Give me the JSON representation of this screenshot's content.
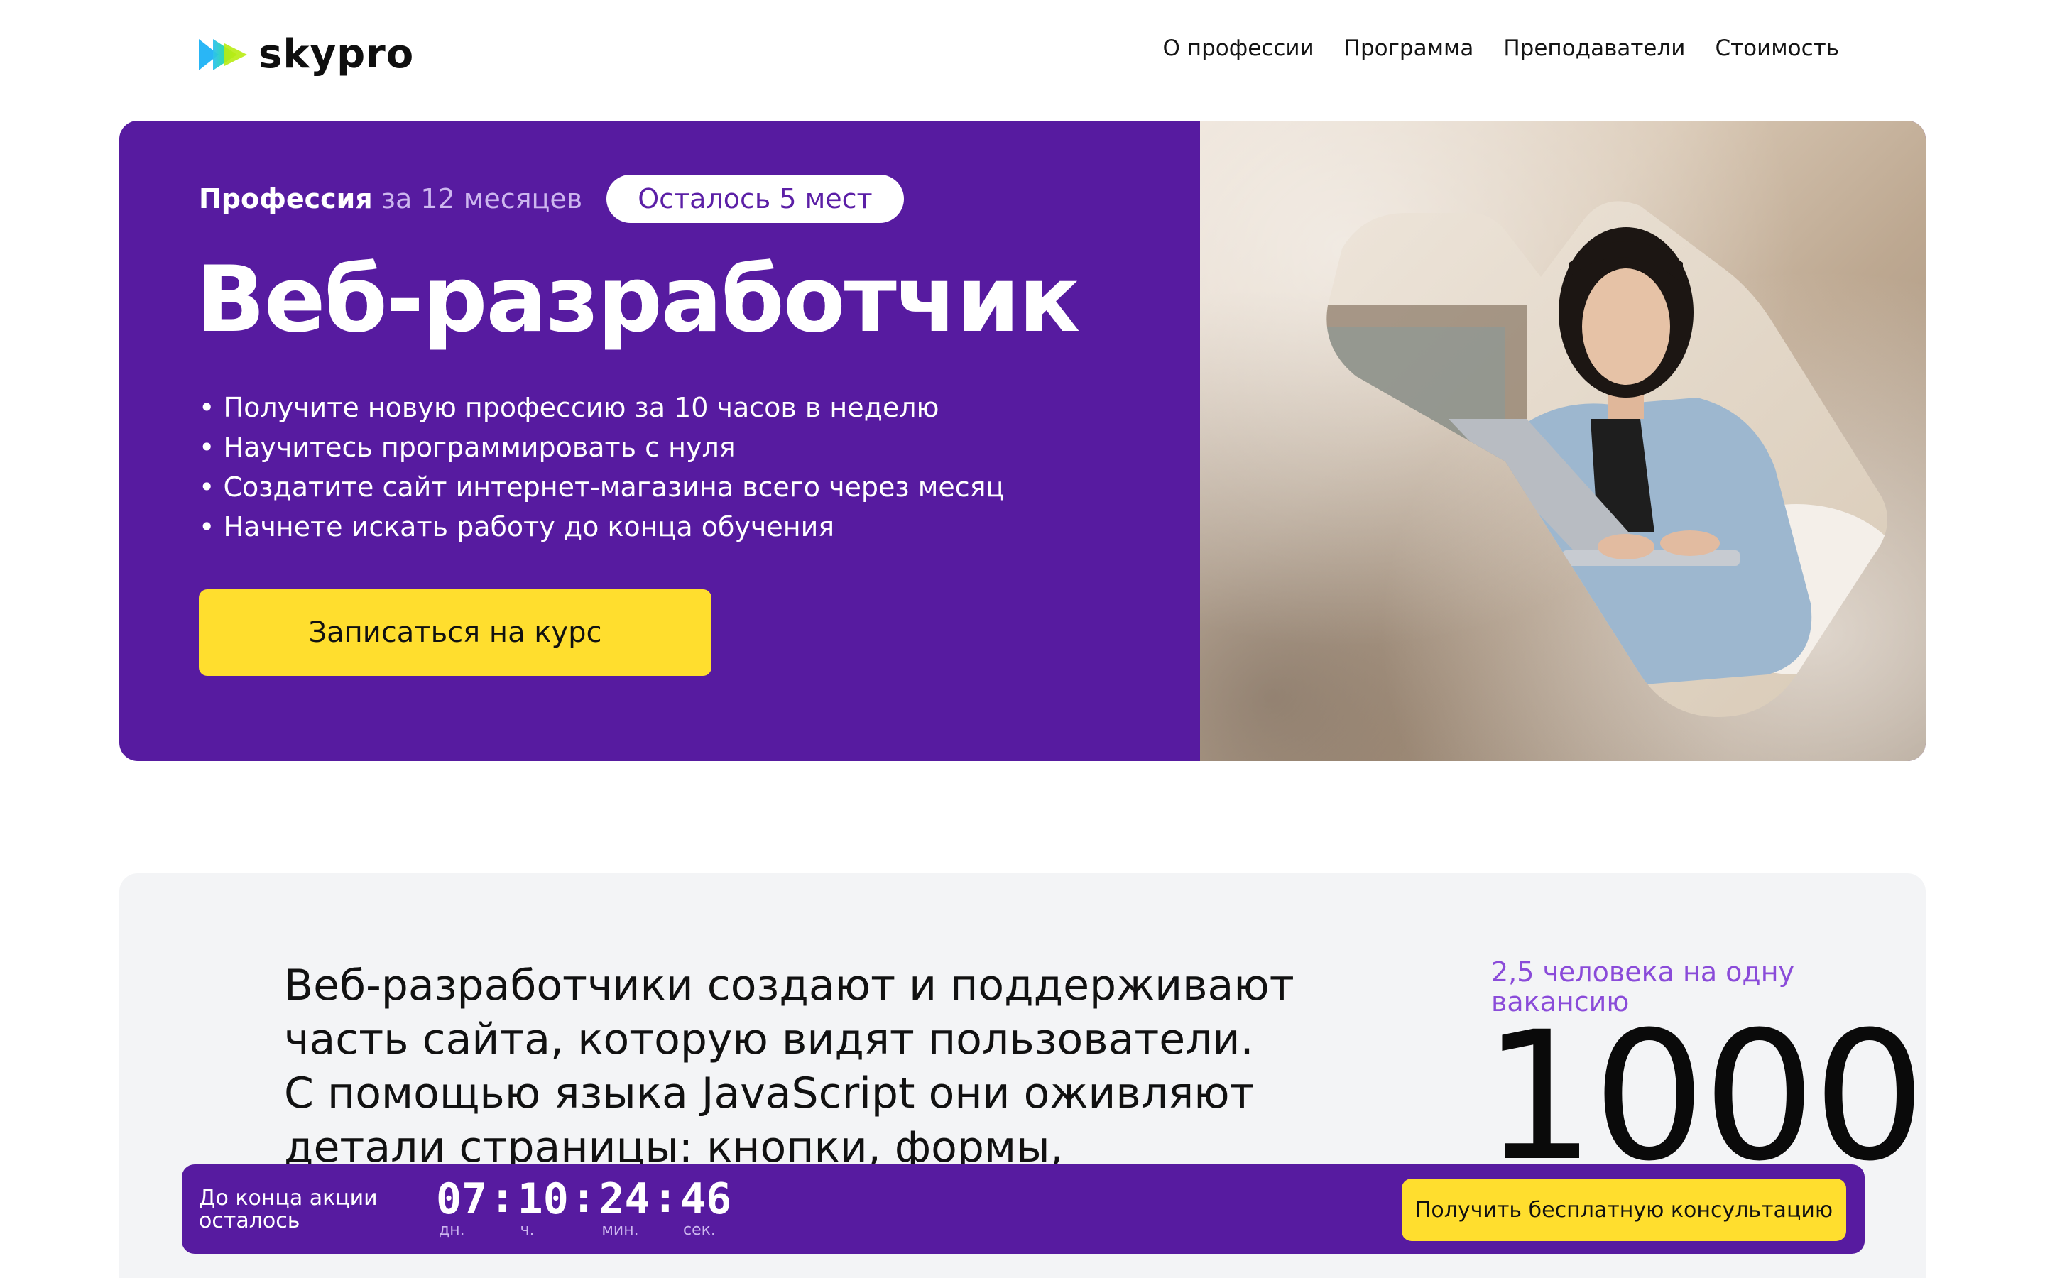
{
  "header": {
    "logo_text": "skypro",
    "nav": [
      "О профессии",
      "Программа",
      "Преподаватели",
      "Стоимость"
    ]
  },
  "hero": {
    "meta_bold": "Профессия",
    "meta_rest": " за 12 месяцев",
    "pill": "Осталось 5 мест",
    "title": "Веб-разработчик",
    "bullets": [
      "Получите новую профессию за 10 часов в неделю",
      "Научитесь программировать с нуля",
      "Создатите сайт интернет-магазина всего через месяц",
      "Начнете искать работу до конца обучения"
    ],
    "cta": "Записаться на курс",
    "photo_icon": "person-with-laptop-photo"
  },
  "info": {
    "text_lines": [
      "Веб-разработчики создают и поддерживают",
      "часть сайта, которую видят пользователи.",
      "С помощью языка JavaScript они оживляют",
      "детали страницы: кнопки, формы, изображения."
    ],
    "stat_label": "2,5 человека на одну вакансию",
    "stat_value": "1000"
  },
  "countdown": {
    "label_line1": "До конца акции",
    "label_line2": "осталось",
    "days": "07",
    "days_label": "дн.",
    "hours": "10",
    "hours_label": "ч.",
    "minutes": "24",
    "minutes_label": "мин.",
    "seconds": "46",
    "seconds_label": "сек.",
    "button": "Получить бесплатную консультацию"
  },
  "colors": {
    "brand_purple": "#571ba0",
    "accent_yellow": "#ffde2e",
    "stat_purple": "#8a4bd9"
  }
}
